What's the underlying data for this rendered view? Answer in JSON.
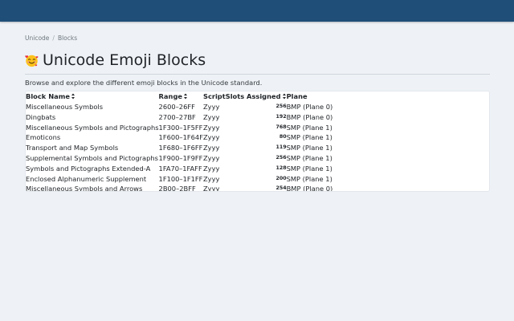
{
  "breadcrumb": {
    "items": [
      "Unicode",
      "Blocks"
    ],
    "separator": "/"
  },
  "page": {
    "title_emoji": "smiling-face-with-hearts",
    "title": "Unicode Emoji Blocks",
    "description": "Browse and explore the different emoji blocks in the Unicode standard."
  },
  "table": {
    "headers": {
      "name": "Block Name",
      "range": "Range",
      "script": "Script",
      "slots": "Slots Assigned",
      "plane": "Plane"
    },
    "rows": [
      {
        "name": "Miscellaneous Symbols",
        "range": "2600–26FF",
        "script": "Zyyy",
        "slots": "256",
        "plane": "BMP (Plane 0)"
      },
      {
        "name": "Dingbats",
        "range": "2700–27BF",
        "script": "Zyyy",
        "slots": "192",
        "plane": "BMP (Plane 0)"
      },
      {
        "name": "Miscellaneous Symbols and Pictographs",
        "range": "1F300–1F5FF",
        "script": "Zyyy",
        "slots": "768",
        "plane": "SMP (Plane 1)"
      },
      {
        "name": "Emoticons",
        "range": "1F600–1F64F",
        "script": "Zyyy",
        "slots": "80",
        "plane": "SMP (Plane 1)"
      },
      {
        "name": "Transport and Map Symbols",
        "range": "1F680–1F6FF",
        "script": "Zyyy",
        "slots": "119",
        "plane": "SMP (Plane 1)"
      },
      {
        "name": "Supplemental Symbols and Pictographs",
        "range": "1F900–1F9FF",
        "script": "Zyyy",
        "slots": "256",
        "plane": "SMP (Plane 1)"
      },
      {
        "name": "Symbols and Pictographs Extended-A",
        "range": "1FA70–1FAFF",
        "script": "Zyyy",
        "slots": "128",
        "plane": "SMP (Plane 1)"
      },
      {
        "name": "Enclosed Alphanumeric Supplement",
        "range": "1F100–1F1FF",
        "script": "Zyyy",
        "slots": "200",
        "plane": "SMP (Plane 1)"
      },
      {
        "name": "Miscellaneous Symbols and Arrows",
        "range": "2B00–2BFF",
        "script": "Zyyy",
        "slots": "254",
        "plane": "BMP (Plane 0)"
      }
    ]
  },
  "colors": {
    "header_bar": "#1f4e79",
    "page_background": "#eef2f6",
    "card_background": "#ffffff"
  }
}
